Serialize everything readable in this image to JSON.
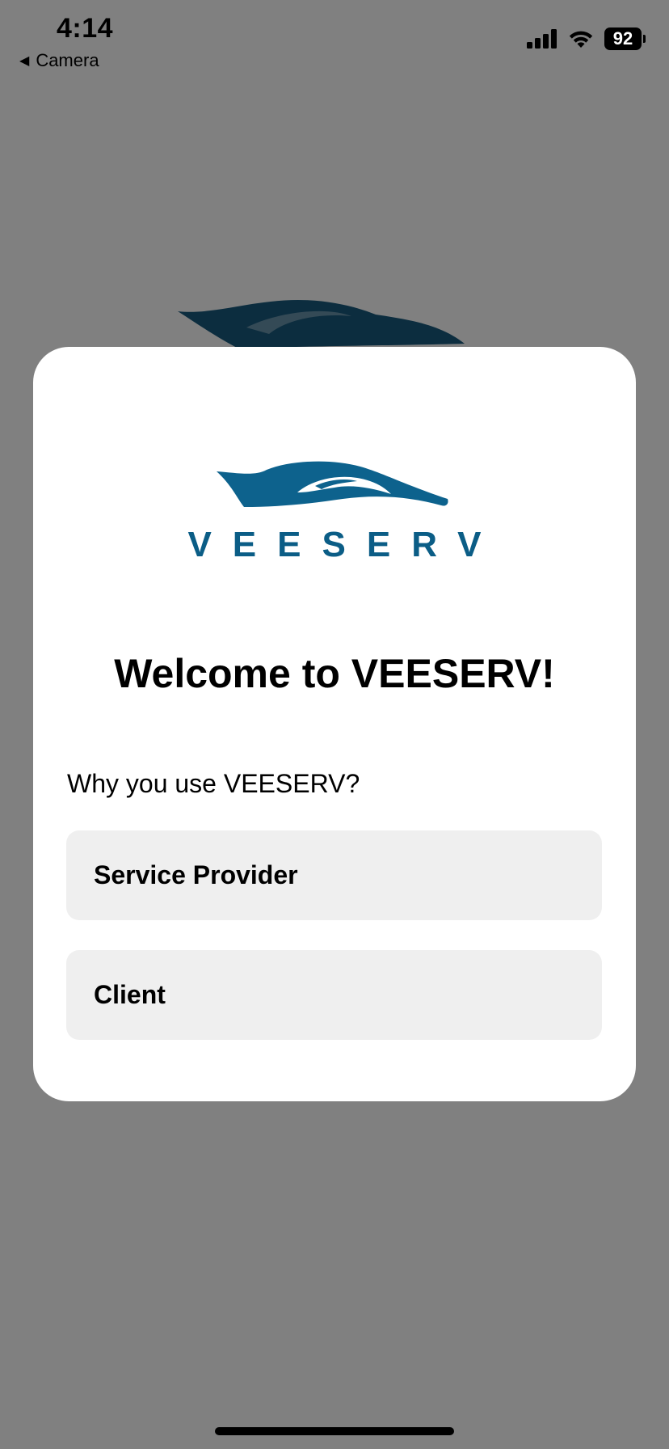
{
  "status_bar": {
    "time": "4:14",
    "back_label": "Camera",
    "battery_level": "92"
  },
  "brand": {
    "name": "VEESERV",
    "color": "#0b5d86"
  },
  "modal": {
    "title": "Welcome to VEESERV!",
    "question": "Why you use VEESERV?",
    "options": [
      {
        "label": "Service Provider"
      },
      {
        "label": "Client"
      }
    ]
  },
  "colors": {
    "overlay": "#808080",
    "card": "#ffffff",
    "option_bg": "#efefef"
  }
}
